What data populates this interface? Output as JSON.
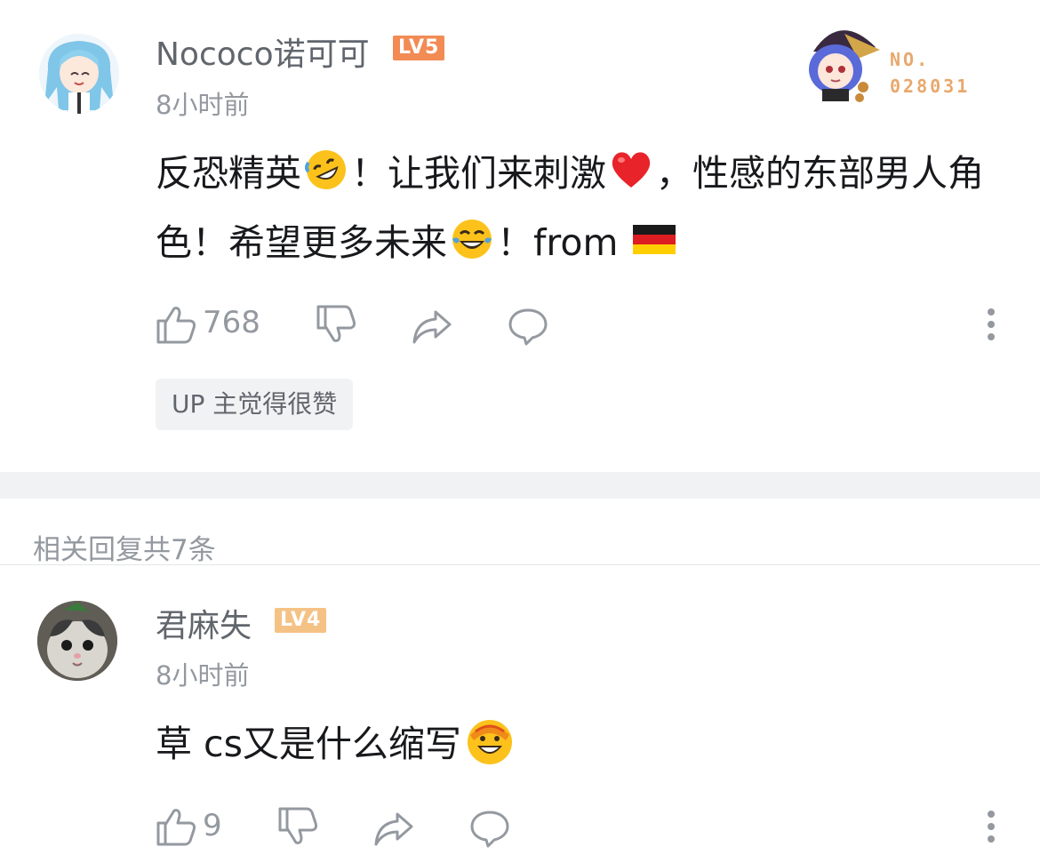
{
  "comment": {
    "username": "Nococo诺可可",
    "level": "LV5",
    "level_color": "#f28b54",
    "time": "8小时前",
    "content_parts": {
      "p1": "反恐精英",
      "p2": "！让我们来刺激",
      "p3": "，性感的东部男人角色！希望更多未来",
      "p4": "！from "
    },
    "emojis": [
      "rofl-emoji",
      "red-heart-emoji",
      "tears-of-joy-emoji",
      "germany-flag-emoji"
    ],
    "likes": "768",
    "up_tag": "UP 主觉得很赞",
    "fan_badge": {
      "line1": "NO.",
      "line2": "028031"
    }
  },
  "replies_header": "相关回复共7条",
  "reply": {
    "username": "君麻失",
    "level": "LV4",
    "level_color": "#f5c286",
    "time": "8小时前",
    "content": "草 cs又是什么缩写",
    "emoji": "laughing-cover-face-emoji",
    "likes": "9"
  },
  "colors": {
    "text": "#18191c",
    "secondary": "#61666d",
    "muted": "#9499a0",
    "band": "#f1f2f3"
  }
}
